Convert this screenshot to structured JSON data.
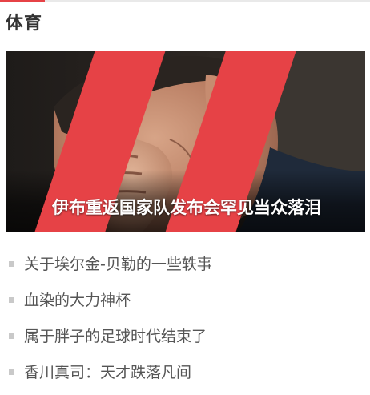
{
  "section": {
    "title": "体育"
  },
  "featured": {
    "headline": "伊布重返国家队发布会罕见当众落泪",
    "image": "photo-of-man-covering-face-with-hand",
    "accent_color": "#e64246"
  },
  "news": [
    {
      "title": "关于埃尔金-贝勒的一些轶事"
    },
    {
      "title": "血染的大力神杯"
    },
    {
      "title": "属于胖子的足球时代结束了"
    },
    {
      "title": "香川真司：天才跌落凡间"
    }
  ],
  "colors": {
    "accent": "#e64246",
    "title_text": "#333333",
    "list_text": "#555555",
    "bullet": "#c9c9c9"
  }
}
